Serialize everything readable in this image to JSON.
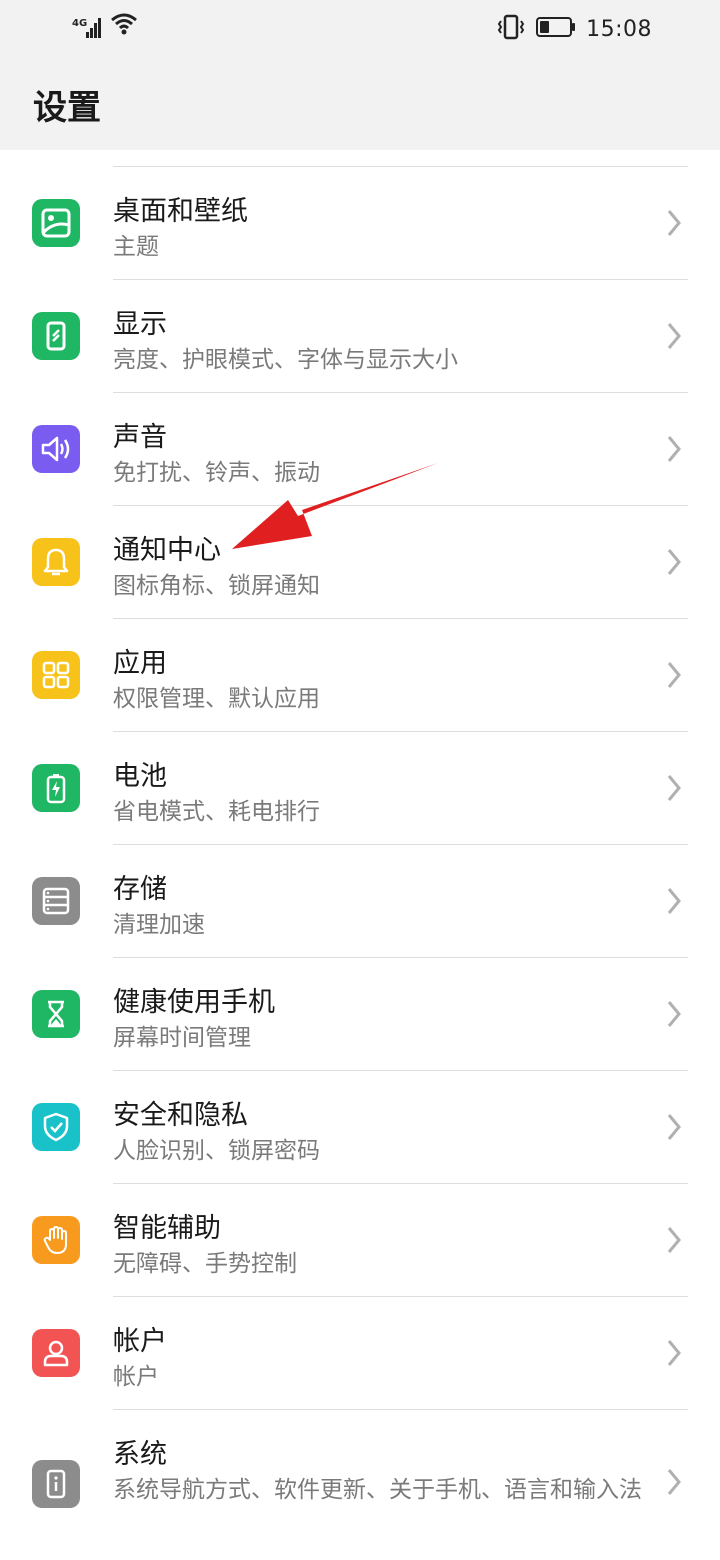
{
  "status_bar": {
    "network_label": "4G",
    "time": "15:08",
    "icons": [
      "signal-icon",
      "wifi-icon",
      "vibrate-icon",
      "battery-icon"
    ]
  },
  "header": {
    "title": "设置"
  },
  "settings": [
    {
      "title": "桌面和壁纸",
      "subtitle": "主题",
      "icon": "wallpaper-icon",
      "color": "#1fb764"
    },
    {
      "title": "显示",
      "subtitle": "亮度、护眼模式、字体与显示大小",
      "icon": "display-icon",
      "color": "#1fb764"
    },
    {
      "title": "声音",
      "subtitle": "免打扰、铃声、振动",
      "icon": "sound-icon",
      "color": "#7a5cf0"
    },
    {
      "title": "通知中心",
      "subtitle": "图标角标、锁屏通知",
      "icon": "bell-icon",
      "color": "#f7c21a"
    },
    {
      "title": "应用",
      "subtitle": "权限管理、默认应用",
      "icon": "apps-icon",
      "color": "#f7c21a"
    },
    {
      "title": "电池",
      "subtitle": "省电模式、耗电排行",
      "icon": "battery-charge-icon",
      "color": "#1fb764"
    },
    {
      "title": "存储",
      "subtitle": "清理加速",
      "icon": "storage-icon",
      "color": "#8c8c8c"
    },
    {
      "title": "健康使用手机",
      "subtitle": "屏幕时间管理",
      "icon": "hourglass-icon",
      "color": "#1fb764"
    },
    {
      "title": "安全和隐私",
      "subtitle": "人脸识别、锁屏密码",
      "icon": "shield-icon",
      "color": "#19c2c9"
    },
    {
      "title": "智能辅助",
      "subtitle": "无障碍、手势控制",
      "icon": "hand-icon",
      "color": "#f79a1e"
    },
    {
      "title": "帐户",
      "subtitle": "帐户",
      "icon": "account-icon",
      "color": "#f25454"
    },
    {
      "title": "系统",
      "subtitle": "系统导航方式、软件更新、关于手机、语言和输入法",
      "icon": "system-info-icon",
      "color": "#8c8c8c"
    }
  ],
  "annotation": {
    "type": "arrow",
    "color": "#e02020",
    "points_to": "通知中心"
  }
}
